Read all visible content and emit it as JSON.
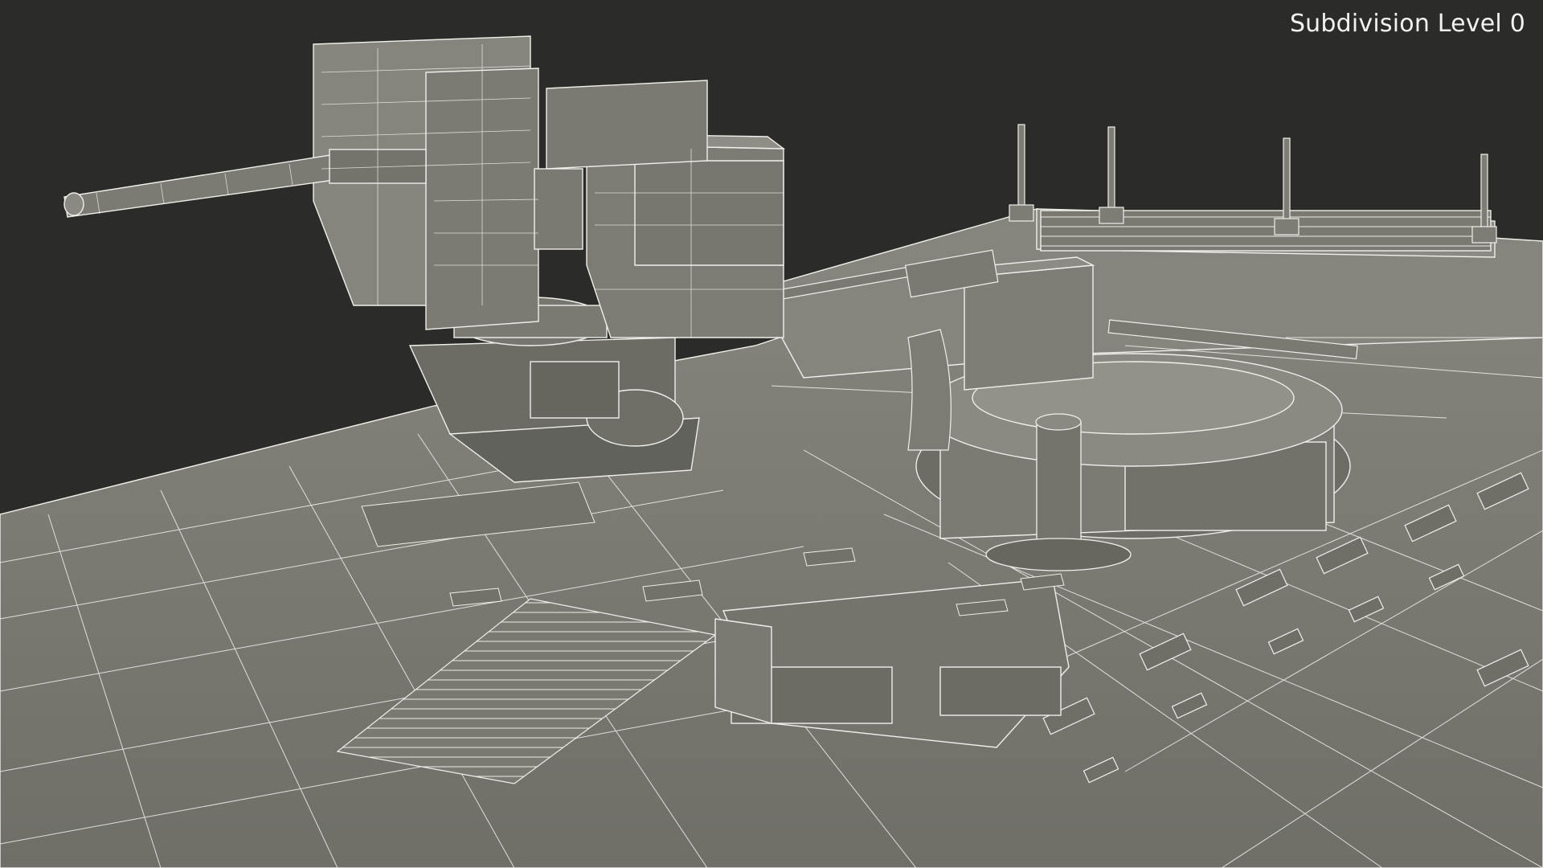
{
  "overlay": {
    "subdivision_label": "Subdivision Level 0"
  },
  "scene": {
    "subject": "armored-vehicle-turret-wireframe",
    "background_color": "#2b2b2a",
    "surface_color": "#7e7e76",
    "wire_color": "#f0f0ea"
  }
}
